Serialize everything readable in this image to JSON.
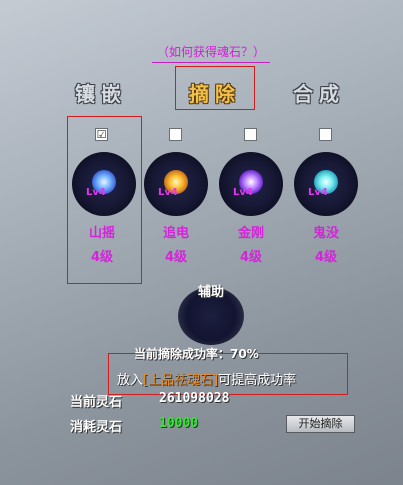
{
  "help_link": "（如何获得魂石？）",
  "tabs": [
    {
      "label": "镶嵌",
      "active": false
    },
    {
      "label": "摘除",
      "active": true
    },
    {
      "label": "合成",
      "active": false
    }
  ],
  "gems": [
    {
      "name": "山摇",
      "level_text": "4级",
      "badge": "Lv4",
      "checked": true,
      "icon": "blue-gem-icon"
    },
    {
      "name": "追电",
      "level_text": "4级",
      "badge": "Lv4",
      "checked": false,
      "icon": "gold-gem-icon"
    },
    {
      "name": "金刚",
      "level_text": "4级",
      "badge": "Lv4",
      "checked": false,
      "icon": "purple-gem-icon"
    },
    {
      "name": "鬼没",
      "level_text": "4级",
      "badge": "Lv4",
      "checked": false,
      "icon": "cyan-gem-icon"
    }
  ],
  "checkbox_checked_glyph": "☑",
  "aux": {
    "label": "辅助"
  },
  "rate": {
    "text": "当前摘除成功率：70%"
  },
  "hint": {
    "prefix": "放入",
    "stone": "[上品祛魂石]",
    "suffix": "可提高成功率"
  },
  "stats": {
    "current_label": "当前灵石",
    "current_value": "261098028",
    "cost_label": "消耗灵石",
    "cost_value": "10000"
  },
  "start_button": "开始摘除",
  "colors": {
    "accent": "#d424da",
    "stone": "#f08a1c",
    "cost": "#37e436",
    "active_tab": "#f2c14a"
  }
}
